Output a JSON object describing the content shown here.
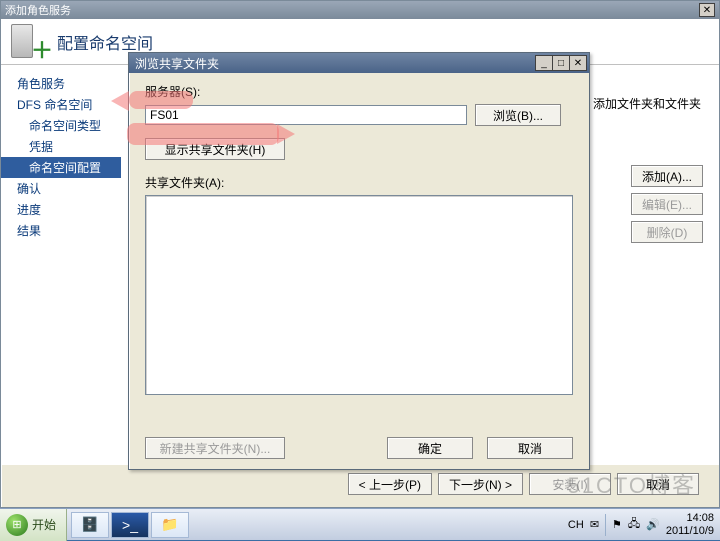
{
  "outer_window": {
    "title": "添加角色服务",
    "wizard_title": "配置命名空间",
    "sidebar": {
      "items": [
        {
          "label": "角色服务",
          "sub": false,
          "selected": false
        },
        {
          "label": "DFS 命名空间",
          "sub": false,
          "selected": false
        },
        {
          "label": "命名空间类型",
          "sub": true,
          "selected": false
        },
        {
          "label": "凭据",
          "sub": true,
          "selected": false
        },
        {
          "label": "命名空间配置",
          "sub": true,
          "selected": true
        },
        {
          "label": "确认",
          "sub": false,
          "selected": false
        },
        {
          "label": "进度",
          "sub": false,
          "selected": false
        },
        {
          "label": "结果",
          "sub": false,
          "selected": false
        }
      ]
    },
    "main_help_text": "添加文件夹和文件夹",
    "right_buttons": {
      "add": "添加(A)...",
      "edit": "编辑(E)...",
      "delete": "删除(D)"
    },
    "footer": {
      "prev": "< 上一步(P)",
      "next": "下一步(N) >",
      "install": "安装(I)",
      "cancel": "取消"
    }
  },
  "dialog": {
    "title": "浏览共享文件夹",
    "server_label": "服务器(S):",
    "server_value": "FS01",
    "browse_btn": "浏览(B)...",
    "show_shared_btn": "显示共享文件夹(H)",
    "shared_folders_label": "共享文件夹(A):",
    "new_shared_btn": "新建共享文件夹(N)...",
    "ok": "确定",
    "cancel": "取消"
  },
  "taskbar": {
    "start_label": "开始",
    "ime": "CH",
    "time": "14:08",
    "date": "2011/10/9"
  },
  "watermark": "51CTO博客",
  "highlight_color": "#f07878"
}
